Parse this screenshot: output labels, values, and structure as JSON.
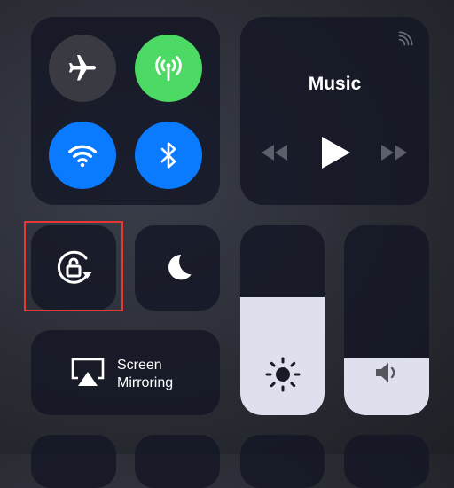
{
  "connectivity": {
    "airplane_icon": "airplane-icon",
    "cellular_icon": "cellular-antenna-icon",
    "wifi_icon": "wifi-icon",
    "bluetooth_icon": "bluetooth-icon",
    "colors": {
      "off": "#3a3b42",
      "cellular_on": "#4cd964",
      "active": "#0a7bff"
    }
  },
  "music": {
    "title": "Music",
    "controls": [
      "rewind-icon",
      "play-icon",
      "fast-forward-icon"
    ]
  },
  "orientation_lock": {
    "icon": "rotation-lock-icon",
    "highlight_color": "#e53935"
  },
  "do_not_disturb": {
    "icon": "moon-icon"
  },
  "screen_mirroring": {
    "line1": "Screen",
    "line2": "Mirroring",
    "icon": "airplay-icon"
  },
  "brightness": {
    "icon": "sun-icon",
    "level_percent": 62
  },
  "volume": {
    "icon": "speaker-icon",
    "level_percent": 30
  }
}
